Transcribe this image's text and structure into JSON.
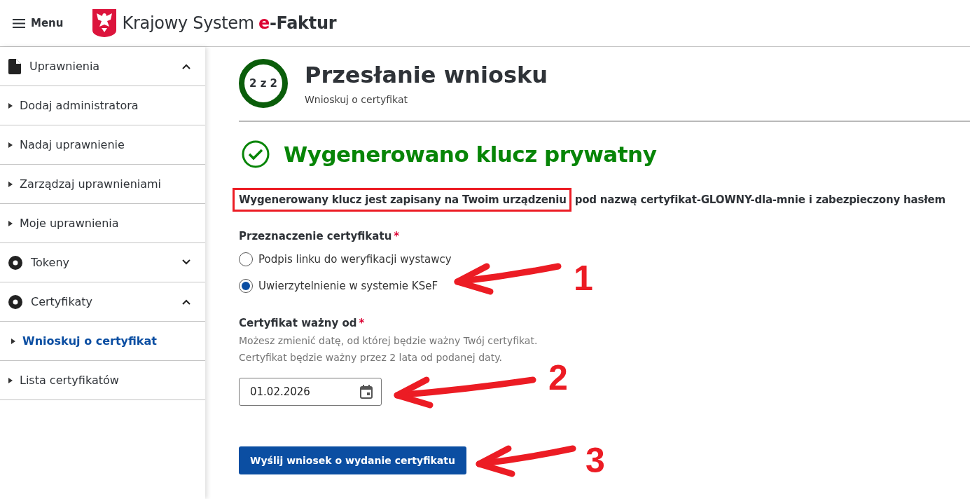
{
  "header": {
    "menu_label": "Menu",
    "title_plain": "Krajowy System",
    "title_accent": "e",
    "title_bold": "-Faktur"
  },
  "sidebar": {
    "groups": [
      {
        "label": "Uprawnienia",
        "kind": "document",
        "expanded": true,
        "children": [
          {
            "label": "Dodaj administratora",
            "selected": false
          },
          {
            "label": "Nadaj uprawnienie",
            "selected": false
          },
          {
            "label": "Zarządzaj uprawnieniami",
            "selected": false
          },
          {
            "label": "Moje uprawnienia",
            "selected": false
          }
        ]
      },
      {
        "label": "Tokeny",
        "kind": "disc",
        "expanded": false
      },
      {
        "label": "Certyfikaty",
        "kind": "disc",
        "expanded": true,
        "children": [
          {
            "label": "Wnioskuj o certyfikat",
            "selected": true
          },
          {
            "label": "Lista certyfikatów",
            "selected": false
          }
        ]
      }
    ]
  },
  "step": {
    "badge": "2 z 2",
    "title": "Przesłanie wniosku",
    "subtitle": "Wnioskuj o certyfikat"
  },
  "success": {
    "title": "Wygenerowano klucz prywatny"
  },
  "info": {
    "highlighted": "Wygenerowany klucz jest zapisany na Twoim urządzeniu",
    "rest": "pod nazwą certyfikat-GLOWNY-dla-mnie i zabezpieczony hasłem"
  },
  "purpose": {
    "label": "Przeznaczenie certyfikatu",
    "required_mark": "*",
    "options": [
      {
        "label": "Podpis linku do weryfikacji wystawcy",
        "selected": false
      },
      {
        "label": "Uwierzytelnienie w systemie KSeF",
        "selected": true,
        "annotation": "1"
      }
    ]
  },
  "valid_from": {
    "label": "Certyfikat ważny od",
    "required_mark": "*",
    "hint": "Możesz zmienić datę, od której będzie ważny Twój certyfikat. Certyfikat będzie ważny przez 2 lata od podanej daty.",
    "value": "01.02.2026",
    "annotation": "2"
  },
  "submit": {
    "label": "Wyślij wniosek o wydanie certyfikatu",
    "annotation": "3"
  }
}
